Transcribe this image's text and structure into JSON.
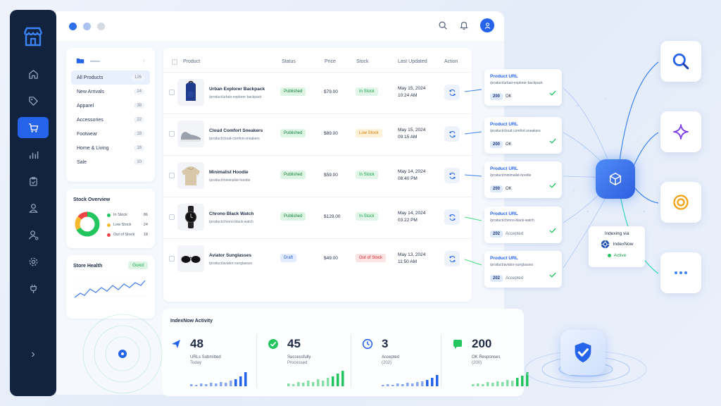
{
  "sidebar": {
    "items": [
      {
        "icon": "home-icon"
      },
      {
        "icon": "tag-icon"
      },
      {
        "icon": "cart-icon",
        "active": true
      },
      {
        "icon": "bar-chart-icon"
      },
      {
        "icon": "clipboard-icon"
      },
      {
        "icon": "users-icon"
      },
      {
        "icon": "user-settings-icon"
      },
      {
        "icon": "gear-icon"
      },
      {
        "icon": "plug-icon"
      }
    ],
    "expand_label": "›"
  },
  "topbar": {
    "dot_colors": [
      "#2f6fe8",
      "#a9c2f0",
      "#d6dbe3"
    ]
  },
  "categories": {
    "chevron": "›",
    "items": [
      {
        "label": "All Products",
        "count": "126"
      },
      {
        "label": "New Arrivals",
        "count": "24"
      },
      {
        "label": "Apparel",
        "count": "38"
      },
      {
        "label": "Accessories",
        "count": "22"
      },
      {
        "label": "Footwear",
        "count": "18"
      },
      {
        "label": "Home & Living",
        "count": "16"
      },
      {
        "label": "Sale",
        "count": "10"
      }
    ]
  },
  "stock_overview": {
    "title": "Stock Overview",
    "legend": [
      {
        "label": "In Stock",
        "value": 86,
        "color": "#22c55e"
      },
      {
        "label": "Low Stock",
        "value": 24,
        "color": "#f5b82e"
      },
      {
        "label": "Out of Stock",
        "value": 18,
        "color": "#ef4444"
      }
    ]
  },
  "store_health": {
    "title": "Store Health",
    "badge": "Good"
  },
  "table": {
    "headers": {
      "product": "Product",
      "status": "Status",
      "price": "Price",
      "stock": "Stock",
      "updated": "Last Updated",
      "action": "Action"
    },
    "rows": [
      {
        "name": "Urban Explorer Backpack",
        "url": "/product/urban-explorer-backpack",
        "status": "Published",
        "price": "$79.00",
        "stock": "In Stock",
        "date": "May 15, 2024",
        "time": "10:24 AM"
      },
      {
        "name": "Cloud Comfort Sneakers",
        "url": "/product/cloud-comfort-sneakers",
        "status": "Published",
        "price": "$89.00",
        "stock": "Low Stock",
        "date": "May 15, 2024",
        "time": "09:15 AM"
      },
      {
        "name": "Minimalist Hoodie",
        "url": "/product/minimalist-hoodie",
        "status": "Published",
        "price": "$59.00",
        "stock": "In Stock",
        "date": "May 14, 2024",
        "time": "08:40 PM"
      },
      {
        "name": "Chrono Black Watch",
        "url": "/product/chrono-black-watch",
        "status": "Published",
        "price": "$129.00",
        "stock": "In Stock",
        "date": "May 14, 2024",
        "time": "03:22 PM"
      },
      {
        "name": "Aviator Sunglasses",
        "url": "/product/aviator-sunglasses",
        "status": "Draft",
        "price": "$49.00",
        "stock": "Out of Stock",
        "date": "May 13, 2024",
        "time": "11:50 AM"
      }
    ]
  },
  "url_cards": [
    {
      "title": "Product URL",
      "url": "/product/urban-explorer-backpack",
      "code": "200",
      "text": "OK"
    },
    {
      "title": "Product URL",
      "url": "/product/cloud-comfort-sneakers",
      "code": "200",
      "text": "OK"
    },
    {
      "title": "Product URL",
      "url": "/product/minimalist-hoodie",
      "code": "200",
      "text": "OK"
    },
    {
      "title": "Product URL",
      "url": "/product/chrono-black-watch",
      "code": "202",
      "text": "Accepted"
    },
    {
      "title": "Product URL",
      "url": "/product/aviator-sunglasses",
      "code": "202",
      "text": "Accepted"
    }
  ],
  "indexing": {
    "title": "Indexing via",
    "service": "IndexNow",
    "status": "Active"
  },
  "right_tiles": [
    "search-icon",
    "sparkle-icon",
    "target-icon",
    "more-icon"
  ],
  "activity": {
    "title": "IndexNow Activity",
    "stats": [
      {
        "value": "48",
        "line1": "URLs Submitted",
        "line2": "Today",
        "icon": "send-icon",
        "color": "#2563eb"
      },
      {
        "value": "45",
        "line1": "Successfully",
        "line2": "Processed",
        "icon": "check-circle-icon",
        "color": "#22c55e"
      },
      {
        "value": "3",
        "line1": "Accepted",
        "line2": "(202)",
        "icon": "clock-icon",
        "color": "#2563eb"
      },
      {
        "value": "200",
        "line1": "OK Responses",
        "line2": "(200)",
        "icon": "message-icon",
        "color": "#22c55e"
      }
    ]
  }
}
